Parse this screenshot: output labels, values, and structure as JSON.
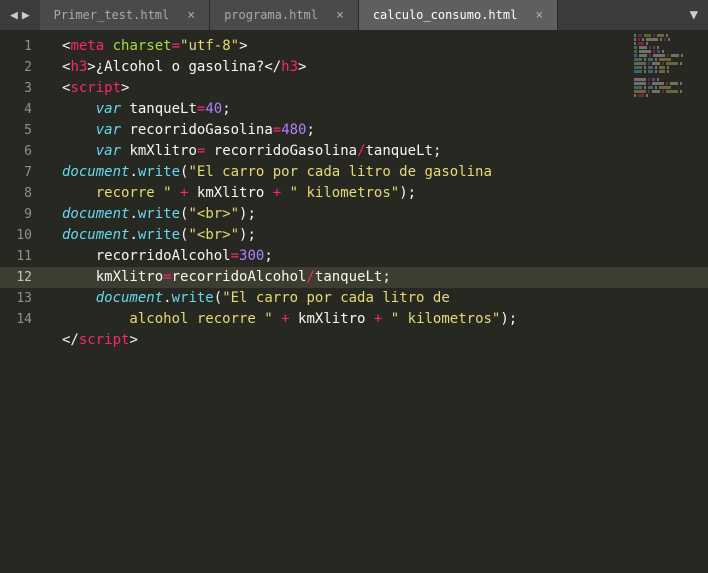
{
  "titlebar": {
    "tabs": [
      {
        "label": "Primer_test.html",
        "active": false
      },
      {
        "label": "programa.html",
        "active": false
      },
      {
        "label": "calculo_consumo.html",
        "active": true
      }
    ]
  },
  "gutter": {
    "lines": [
      "1",
      "2",
      "3",
      "4",
      "5",
      "6",
      "7",
      "",
      "8",
      "9",
      "10",
      "11",
      "12",
      "13",
      "",
      "14"
    ],
    "current": 12
  },
  "code": {
    "lines": [
      [
        {
          "t": "<",
          "c": "p-punc"
        },
        {
          "t": "meta",
          "c": "p-tag"
        },
        {
          "t": " ",
          "c": "p-punc"
        },
        {
          "t": "charset",
          "c": "p-attr"
        },
        {
          "t": "=",
          "c": "p-op"
        },
        {
          "t": "\"utf-8\"",
          "c": "p-str"
        },
        {
          "t": ">",
          "c": "p-punc"
        }
      ],
      [
        {
          "t": "<",
          "c": "p-punc"
        },
        {
          "t": "h3",
          "c": "p-tag"
        },
        {
          "t": ">",
          "c": "p-punc"
        },
        {
          "t": "¿Alcohol o gasolina?",
          "c": "p-white"
        },
        {
          "t": "</",
          "c": "p-punc"
        },
        {
          "t": "h3",
          "c": "p-tag"
        },
        {
          "t": ">",
          "c": "p-punc"
        }
      ],
      [
        {
          "t": "<",
          "c": "p-punc"
        },
        {
          "t": "script",
          "c": "p-tag"
        },
        {
          "t": ">",
          "c": "p-punc"
        }
      ],
      [
        {
          "t": "    ",
          "c": "p-punc"
        },
        {
          "t": "var",
          "c": "p-kw"
        },
        {
          "t": " ",
          "c": "p-punc"
        },
        {
          "t": "tanqueLt",
          "c": "p-var"
        },
        {
          "t": "=",
          "c": "p-op"
        },
        {
          "t": "40",
          "c": "p-num"
        },
        {
          "t": ";",
          "c": "p-punc"
        }
      ],
      [
        {
          "t": "    ",
          "c": "p-punc"
        },
        {
          "t": "var",
          "c": "p-kw"
        },
        {
          "t": " ",
          "c": "p-punc"
        },
        {
          "t": "recorridoGasolina",
          "c": "p-var"
        },
        {
          "t": "=",
          "c": "p-op"
        },
        {
          "t": "480",
          "c": "p-num"
        },
        {
          "t": ";",
          "c": "p-punc"
        }
      ],
      [
        {
          "t": "    ",
          "c": "p-punc"
        },
        {
          "t": "var",
          "c": "p-kw"
        },
        {
          "t": " ",
          "c": "p-punc"
        },
        {
          "t": "kmXlitro",
          "c": "p-var"
        },
        {
          "t": "=",
          "c": "p-op"
        },
        {
          "t": " ",
          "c": "p-punc"
        },
        {
          "t": "recorridoGasolina",
          "c": "p-var"
        },
        {
          "t": "/",
          "c": "p-op"
        },
        {
          "t": "tanqueLt",
          "c": "p-var"
        },
        {
          "t": ";",
          "c": "p-punc"
        }
      ],
      [
        {
          "t": "document",
          "c": "p-obj"
        },
        {
          "t": ".",
          "c": "p-punc"
        },
        {
          "t": "write",
          "c": "p-func"
        },
        {
          "t": "(",
          "c": "p-punc"
        },
        {
          "t": "\"El carro por cada litro de gasolina ",
          "c": "p-str"
        }
      ],
      [
        {
          "t": "    recorre \"",
          "c": "p-str"
        },
        {
          "t": " ",
          "c": "p-punc"
        },
        {
          "t": "+",
          "c": "p-op"
        },
        {
          "t": " ",
          "c": "p-punc"
        },
        {
          "t": "kmXlitro",
          "c": "p-var"
        },
        {
          "t": " ",
          "c": "p-punc"
        },
        {
          "t": "+",
          "c": "p-op"
        },
        {
          "t": " ",
          "c": "p-punc"
        },
        {
          "t": "\" kilometros\"",
          "c": "p-str"
        },
        {
          "t": ");",
          "c": "p-punc"
        }
      ],
      [
        {
          "t": "document",
          "c": "p-obj"
        },
        {
          "t": ".",
          "c": "p-punc"
        },
        {
          "t": "write",
          "c": "p-func"
        },
        {
          "t": "(",
          "c": "p-punc"
        },
        {
          "t": "\"<br>\"",
          "c": "p-str"
        },
        {
          "t": ");",
          "c": "p-punc"
        }
      ],
      [
        {
          "t": "document",
          "c": "p-obj"
        },
        {
          "t": ".",
          "c": "p-punc"
        },
        {
          "t": "write",
          "c": "p-func"
        },
        {
          "t": "(",
          "c": "p-punc"
        },
        {
          "t": "\"<br>\"",
          "c": "p-str"
        },
        {
          "t": ");",
          "c": "p-punc"
        }
      ],
      [
        {
          "t": "",
          "c": "p-punc"
        }
      ],
      [
        {
          "t": "    recorridoAlcohol",
          "c": "p-var"
        },
        {
          "t": "=",
          "c": "p-op"
        },
        {
          "t": "300",
          "c": "p-num"
        },
        {
          "t": ";",
          "c": "p-punc"
        }
      ],
      [
        {
          "t": "    kmXlitro",
          "c": "p-var"
        },
        {
          "t": "=",
          "c": "p-op"
        },
        {
          "t": "recorridoAlcohol",
          "c": "p-var"
        },
        {
          "t": "/",
          "c": "p-op"
        },
        {
          "t": "tanqueLt",
          "c": "p-var"
        },
        {
          "t": ";",
          "c": "p-punc"
        }
      ],
      [
        {
          "t": "    ",
          "c": "p-punc"
        },
        {
          "t": "document",
          "c": "p-obj"
        },
        {
          "t": ".",
          "c": "p-punc"
        },
        {
          "t": "write",
          "c": "p-func"
        },
        {
          "t": "(",
          "c": "p-punc"
        },
        {
          "t": "\"El carro por cada litro de ",
          "c": "p-str"
        }
      ],
      [
        {
          "t": "        alcohol recorre \"",
          "c": "p-str"
        },
        {
          "t": " ",
          "c": "p-punc"
        },
        {
          "t": "+",
          "c": "p-op"
        },
        {
          "t": " ",
          "c": "p-punc"
        },
        {
          "t": "kmXlitro",
          "c": "p-var"
        },
        {
          "t": " ",
          "c": "p-punc"
        },
        {
          "t": "+",
          "c": "p-op"
        },
        {
          "t": " ",
          "c": "p-punc"
        },
        {
          "t": "\" kilometros\"",
          "c": "p-str"
        },
        {
          "t": ");",
          "c": "p-punc"
        }
      ],
      [
        {
          "t": "</",
          "c": "p-punc"
        },
        {
          "t": "script",
          "c": "p-tag"
        },
        {
          "t": ">",
          "c": "p-punc"
        }
      ]
    ],
    "current": 12
  }
}
